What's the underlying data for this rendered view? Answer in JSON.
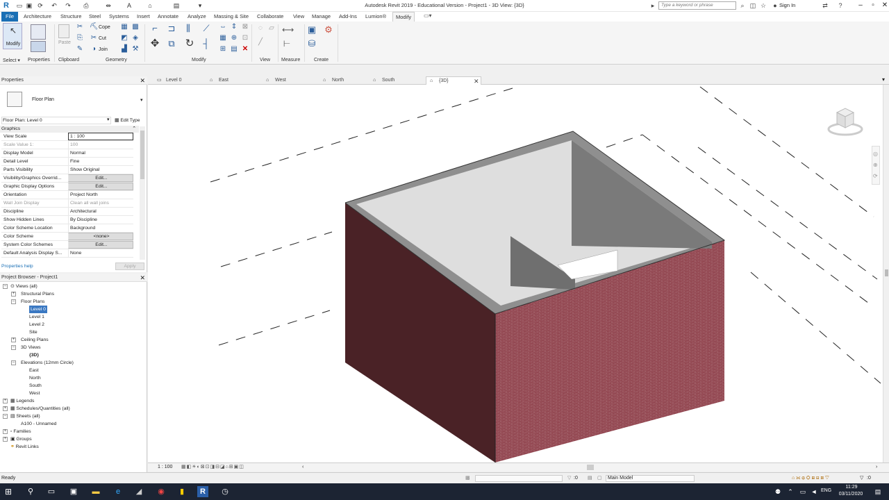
{
  "window": {
    "title": "Autodesk Revit 2019 - Educational Version - Project1 - 3D View: {3D}",
    "search_placeholder": "Type a keyword or phrase",
    "sign_in": "Sign In"
  },
  "ribbon": {
    "tabs": [
      "File",
      "Architecture",
      "Structure",
      "Steel",
      "Systems",
      "Insert",
      "Annotate",
      "Analyze",
      "Massing & Site",
      "Collaborate",
      "View",
      "Manage",
      "Add-Ins",
      "Lumion®",
      "Modify"
    ],
    "active_tab": "Modify",
    "modify_label": "Modify",
    "small_buttons": {
      "cope": "Cope",
      "cut": "Cut",
      "join": "Join"
    },
    "panel_labels": {
      "select": "Select ▾",
      "properties": "Properties",
      "clipboard": "Clipboard",
      "geometry": "Geometry",
      "modify": "Modify",
      "view": "View",
      "measure": "Measure",
      "create": "Create"
    }
  },
  "properties": {
    "header": "Properties",
    "type_name": "Floor Plan",
    "instance": "Floor Plan: Level 0",
    "edit_type": "Edit Type",
    "group": "Graphics",
    "rows": [
      {
        "key": "View Scale",
        "value": "1 : 100"
      },
      {
        "key": "Scale Value    1:",
        "value": "100"
      },
      {
        "key": "Display Model",
        "value": "Normal"
      },
      {
        "key": "Detail Level",
        "value": "Fine"
      },
      {
        "key": "Parts Visibility",
        "value": "Show Original"
      },
      {
        "key": "Visibility/Graphics Overrid...",
        "value": "Edit..."
      },
      {
        "key": "Graphic Display Options",
        "value": "Edit..."
      },
      {
        "key": "Orientation",
        "value": "Project North"
      },
      {
        "key": "Wall Join Display",
        "value": "Clean all wall joins"
      },
      {
        "key": "Discipline",
        "value": "Architectural"
      },
      {
        "key": "Show Hidden Lines",
        "value": "By Discipline"
      },
      {
        "key": "Color Scheme Location",
        "value": "Background"
      },
      {
        "key": "Color Scheme",
        "value": "<none>"
      },
      {
        "key": "System Color Schemes",
        "value": "Edit..."
      },
      {
        "key": "Default Analysis Display S...",
        "value": "None"
      }
    ],
    "help": "Properties help",
    "apply": "Apply"
  },
  "browser": {
    "header": "Project Browser - Project1",
    "views_all": "Views (all)",
    "structural_plans": "Structural Plans",
    "floor_plans": "Floor Plans",
    "floor_items": [
      "Level 0",
      "Level 1",
      "Level 2",
      "Site"
    ],
    "ceiling_plans": "Ceiling Plans",
    "views_3d": "3D Views",
    "view_3d_item": "{3D}",
    "elevations": "Elevations (12mm Circle)",
    "elevation_items": [
      "East",
      "North",
      "South",
      "West"
    ],
    "legends": "Legends",
    "schedules": "Schedules/Quantities (all)",
    "sheets": "Sheets (all)",
    "sheet_item": "A100 - Unnamed",
    "families": "Families",
    "groups": "Groups",
    "revit_links": "Revit Links"
  },
  "view_tabs": [
    "Level 0",
    "East",
    "West",
    "North",
    "South",
    "{3D}"
  ],
  "view_bar": {
    "scale": "1 : 100"
  },
  "status": {
    "text": "Ready",
    "selection": ":0",
    "workset": "Main Model"
  },
  "taskbar": {
    "lang": "ENG",
    "time": "11:29",
    "date": "03/11/2020"
  },
  "colors": {
    "brick": "#8b3a45",
    "brick_dark": "#4a2226",
    "accent": "#1a6fb5"
  }
}
